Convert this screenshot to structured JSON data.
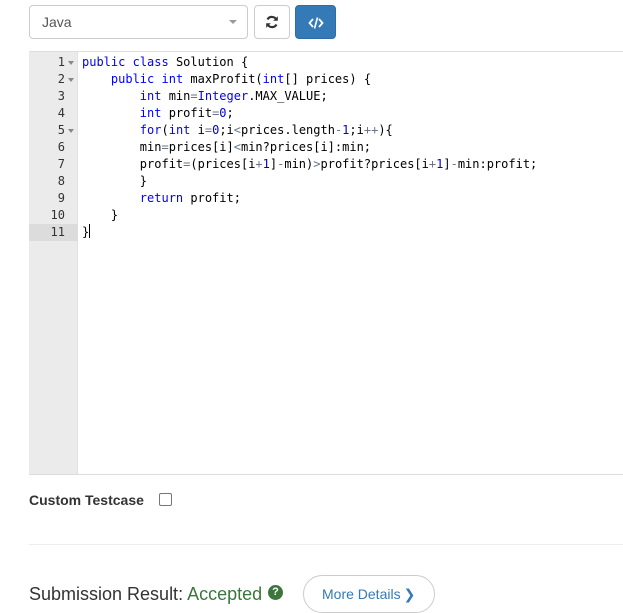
{
  "toolbar": {
    "language": "Java",
    "reset_icon": "refresh-icon",
    "format_icon": "code-icon"
  },
  "editor": {
    "line_numbers": [
      "1",
      "2",
      "3",
      "4",
      "5",
      "6",
      "7",
      "8",
      "9",
      "10",
      "11"
    ],
    "active_line": "11",
    "code_lines": [
      "public class Solution {",
      "    public int maxProfit(int[] prices) {",
      "        int min=Integer.MAX_VALUE;",
      "        int profit=0;",
      "        for(int i=0;i<prices.length-1;i++){",
      "        min=prices[i]<min?prices[i]:min;",
      "        profit=(prices[i+1]-min)>profit?prices[i+1]-min:profit;",
      "        }",
      "        return profit;",
      "    }",
      "}"
    ]
  },
  "testcase": {
    "label": "Custom Testcase",
    "checked": false
  },
  "submission": {
    "label": "Submission Result:",
    "status": "Accepted",
    "status_color": "#3c763d",
    "details_button": "More Details",
    "details_icon": "chevron-right-icon"
  }
}
